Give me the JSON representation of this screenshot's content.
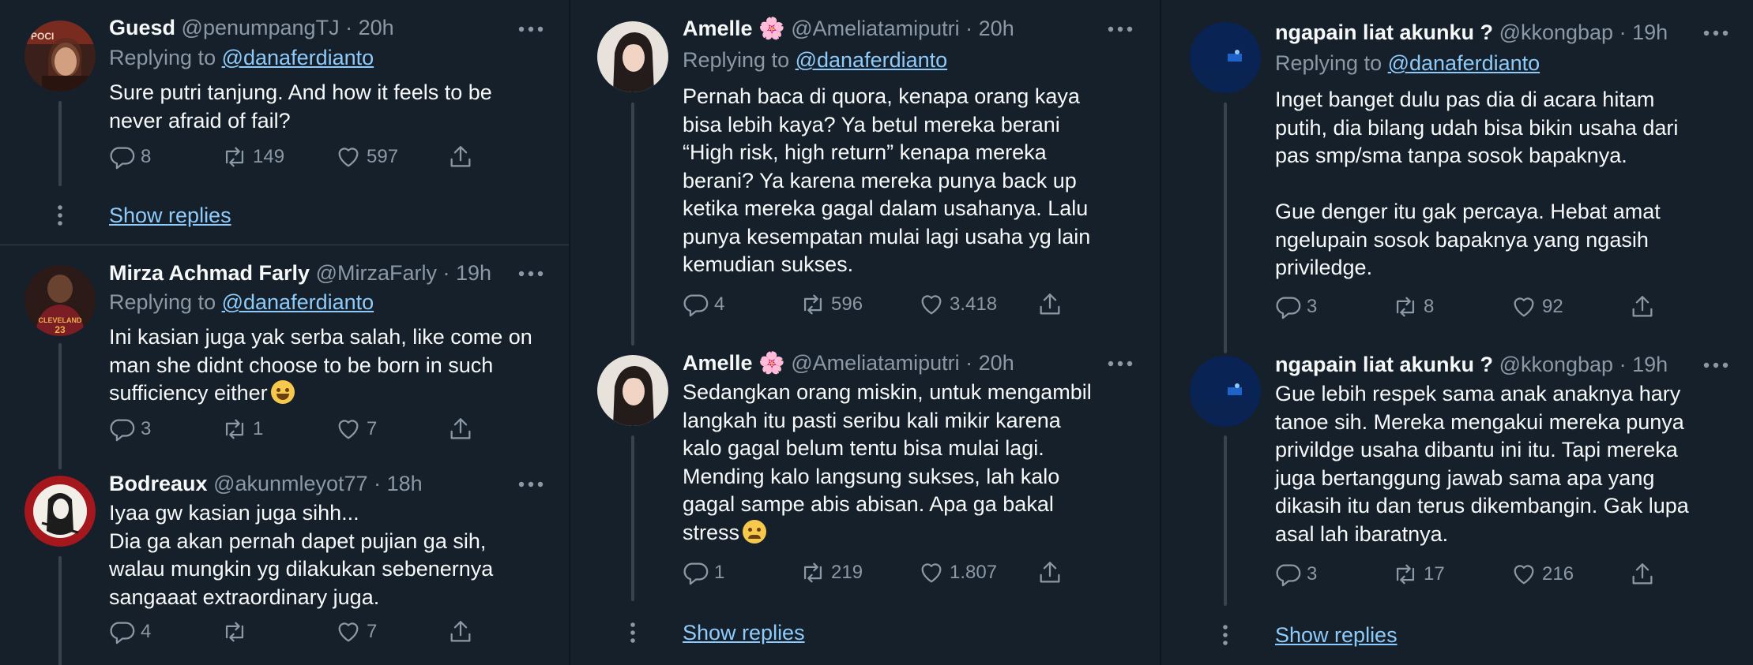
{
  "replying_to_prefix": "Replying to ",
  "show_replies_label": "Show replies",
  "columns": [
    {
      "tweets": [
        {
          "name": "Guesd",
          "handle": "@penumpangTJ",
          "time": "20h",
          "replying_to": "@danaferdianto",
          "text": "Sure putri tanjung. And how it feels to be\nnever afraid of fail?",
          "replies": "8",
          "retweets": "149",
          "likes": "597"
        },
        {
          "name": "Mirza Achmad Farly",
          "handle": "@MirzaFarly",
          "time": "19h",
          "replying_to": "@danaferdianto",
          "text": "Ini kasian juga yak serba salah, like come on\nman she didnt choose to be born in such\nsufficiency either",
          "emoji": "grinning-sweat-emoji",
          "replies": "3",
          "retweets": "1",
          "likes": "7"
        },
        {
          "name": "Bodreaux",
          "handle": "@akunmleyot77",
          "time": "18h",
          "text": "Iyaa gw kasian juga sihh...\nDia ga akan pernah dapet pujian ga sih,\nwalau mungkin yg dilakukan sebenernya\nsangaaat extraordinary juga.",
          "replies": "4",
          "retweets": "",
          "likes": "7"
        }
      ]
    },
    {
      "tweets": [
        {
          "name": "Amelle 🌸",
          "handle": "@Ameliatamiputri",
          "time": "20h",
          "replying_to": "@danaferdianto",
          "text": "Pernah baca di quora, kenapa orang kaya\nbisa lebih kaya? Ya betul mereka berani\n“High risk, high return” kenapa mereka\nberani? Ya karena mereka punya back up\nketika mereka gagal dalam usahanya. Lalu\npunya kesempatan mulai lagi usaha yg lain\nkemudian sukses.",
          "replies": "4",
          "retweets": "596",
          "likes": "3.418"
        },
        {
          "name": "Amelle 🌸",
          "handle": "@Ameliatamiputri",
          "time": "20h",
          "text": "Sedangkan orang miskin, untuk mengambil\nlangkah itu pasti seribu  kali mikir karena\nkalo gagal belum tentu bisa mulai lagi.\nMending kalo langsung sukses, lah kalo\ngagal sampe abis abisan. Apa ga bakal\nstress",
          "emoji": "crying-face-emoji",
          "replies": "1",
          "retweets": "219",
          "likes": "1.807"
        }
      ]
    },
    {
      "tweets": [
        {
          "name": "ngapain liat akunku ?",
          "handle": "@kkongbap",
          "time": "19h",
          "replying_to": "@danaferdianto",
          "text": "Inget banget dulu pas dia di acara hitam\nputih, dia bilang udah bisa bikin usaha dari\npas smp/sma tanpa sosok bapaknya.\n\nGue denger itu gak percaya. Hebat amat\nngelupain sosok bapaknya yang ngasih\npriviledge.",
          "replies": "3",
          "retweets": "8",
          "likes": "92"
        },
        {
          "name": "ngapain liat akunku ?",
          "handle": "@kkongbap",
          "time": "19h",
          "text": "Gue lebih respek sama anak anaknya hary\ntanoe sih. Mereka mengakui mereka punya\nprivildge usaha dibantu ini itu. Tapi mereka\njuga bertanggung jawab sama apa yang\ndikasih itu dan terus dikembangin. Gak lupa\nasal lah ibaratnya.",
          "replies": "3",
          "retweets": "17",
          "likes": "216"
        }
      ]
    }
  ],
  "colors": {
    "background": "#15202b",
    "text": "#f7f9f9",
    "muted": "#8b98a5",
    "link": "#8fcbfa",
    "thread_line": "#38444d"
  }
}
